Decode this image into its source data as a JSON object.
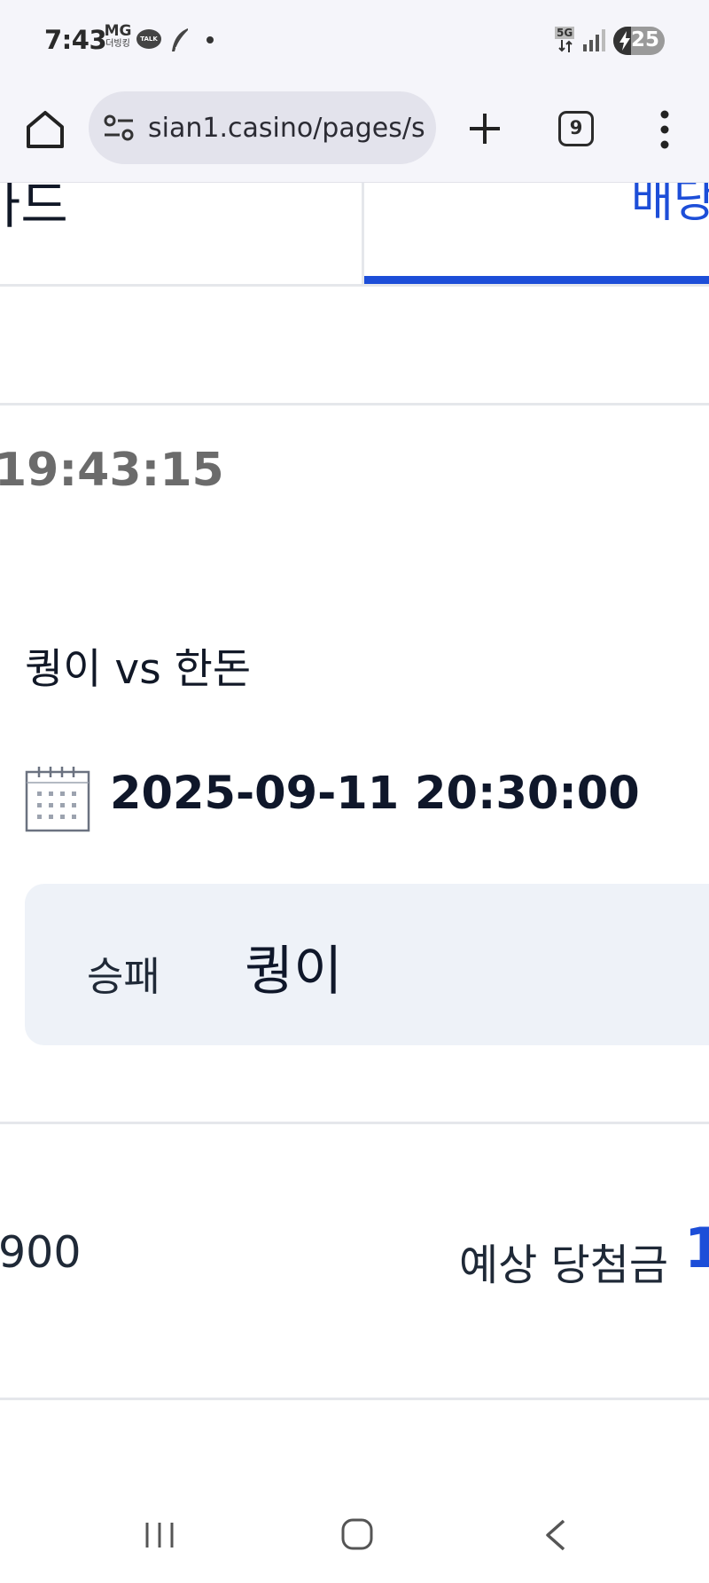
{
  "status_bar": {
    "time": "7:43",
    "mg_label": "MG",
    "mg_sub": "더빙킹",
    "talk_label": "TALK",
    "network": "5G",
    "battery_percent": "25",
    "battery_level": 0.25,
    "icons": [
      "kakaotalk-icon",
      "feather-icon",
      "notification-dot-icon",
      "5g-icon",
      "signal-icon",
      "battery-charging-icon"
    ]
  },
  "browser": {
    "url": "sian1.casino/pages/s",
    "tab_count": "9",
    "icons": [
      "home-icon",
      "site-info-icon",
      "plus-icon",
      "more-vert-icon"
    ]
  },
  "tabs": {
    "left_label": "카드",
    "right_label": "배당"
  },
  "bet_slip": {
    "time": "19:43:15",
    "match": "퀑이 vs 한돈",
    "datetime": "2025-09-11 20:30:00",
    "bet_type_label": "승패",
    "bet_pick": "퀑이",
    "amount_partial": "900",
    "expected_label": "예상 당첨금",
    "expected_value_partial": "1"
  },
  "colors": {
    "accent": "#1d4ed8",
    "card_bg": "#eef2f8",
    "chrome_bg": "#f5f5fa"
  },
  "nav": {
    "icons": [
      "recents-icon",
      "home-circle-icon",
      "back-icon"
    ]
  }
}
